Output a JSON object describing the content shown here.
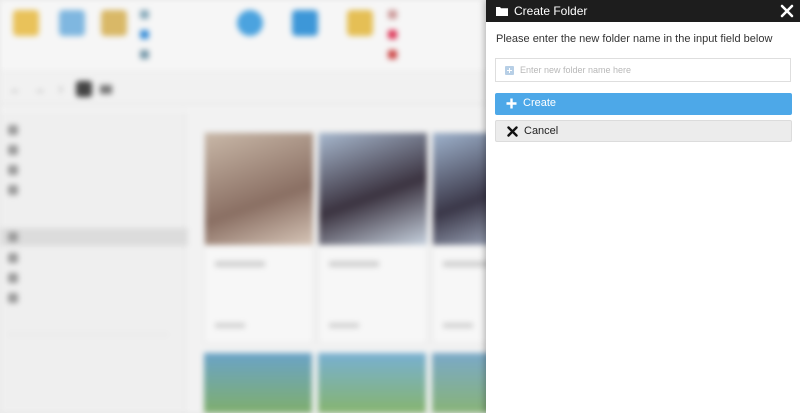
{
  "dialog": {
    "title": "Create Folder",
    "instruction": "Please enter the new folder name in the input field below",
    "input": {
      "value": "",
      "placeholder": "Enter new folder name here"
    },
    "create_label": "Create",
    "cancel_label": "Cancel"
  },
  "icons": {
    "header": "folder-icon",
    "close": "close-icon",
    "input": "plus-square-icon",
    "create": "plus-icon",
    "cancel": "x-icon"
  },
  "colors": {
    "header_bg": "#1d1d1d",
    "create_bg": "#4da8e8",
    "cancel_bg": "#ececec"
  }
}
